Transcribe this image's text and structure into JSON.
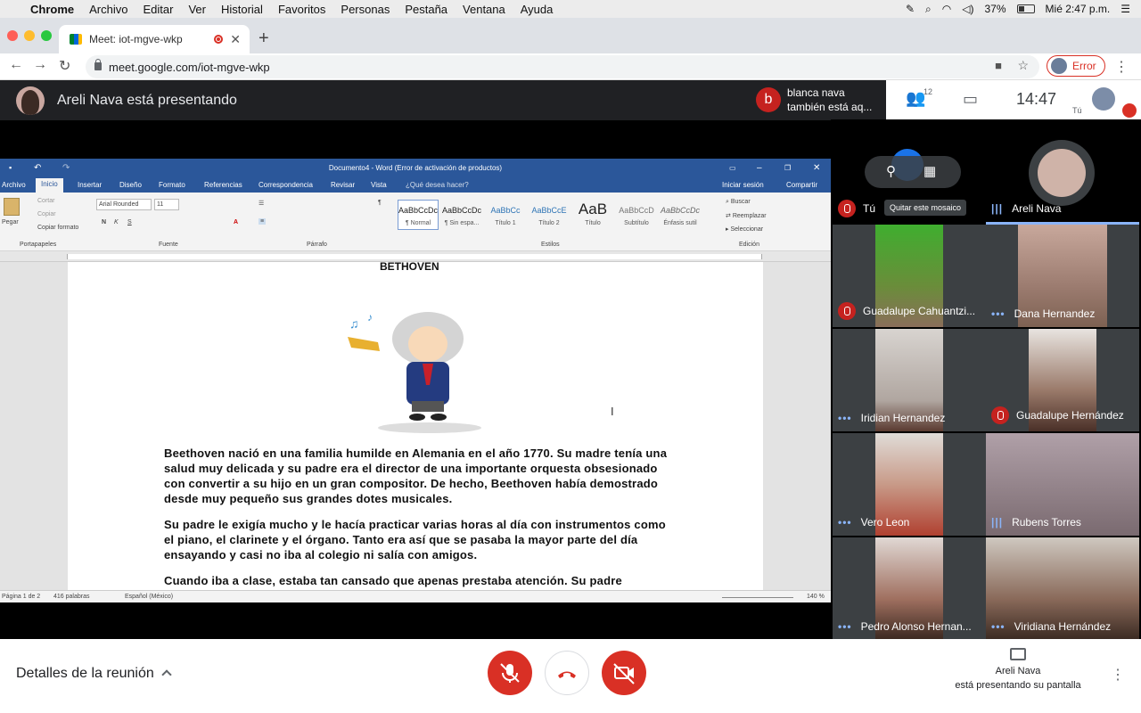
{
  "menubar": {
    "app": "Chrome",
    "items": [
      "Archivo",
      "Editar",
      "Ver",
      "Historial",
      "Favoritos",
      "Personas",
      "Pestaña",
      "Ventana",
      "Ayuda"
    ],
    "battery": "37%",
    "datetime": "Mié 2:47 p.m."
  },
  "browser": {
    "tab_title": "Meet: iot-mgve-wkp",
    "url": "meet.google.com/iot-mgve-wkp",
    "profile_label": "Error"
  },
  "meet": {
    "presenting_banner": "Areli Nava está presentando",
    "toast_initial": "b",
    "toast_line1": "blanca nava",
    "toast_line2": "también está aq...",
    "participants_count": "12",
    "time": "14:47",
    "self_label": "Tú",
    "details_label": "Detalles de la reunión",
    "presenter_name": "Areli Nava",
    "presenter_sub": "está presentando su pantalla",
    "colors": {
      "red": "#d93025",
      "accent": "#8ab4f8",
      "dark": "#202124"
    }
  },
  "word": {
    "title": "Documento4 - Word (Error de activación de productos)",
    "tabs": [
      "Archivo",
      "Inicio",
      "Insertar",
      "Diseño",
      "Formato",
      "Referencias",
      "Correspondencia",
      "Revisar",
      "Vista"
    ],
    "tell_me": "¿Qué desea hacer?",
    "signin": "Iniciar sesión",
    "share": "Compartir",
    "font_name": "Arial Rounded",
    "font_size": "11",
    "clipboard": {
      "paste": "Pegar",
      "cut": "Cortar",
      "copy": "Copiar",
      "format": "Copiar formato"
    },
    "groups": [
      "Portapapeles",
      "Fuente",
      "Párrafo",
      "Estilos",
      "Edición"
    ],
    "styles": [
      {
        "sample": "AaBbCcDc",
        "name": "¶ Normal"
      },
      {
        "sample": "AaBbCcDc",
        "name": "¶ Sin espa..."
      },
      {
        "sample": "AaBbCc",
        "name": "Título 1"
      },
      {
        "sample": "AaBbCcE",
        "name": "Título 2"
      },
      {
        "sample": "AaB",
        "name": "Título"
      },
      {
        "sample": "AaBbCcD",
        "name": "Subtítulo"
      },
      {
        "sample": "AaBbCcDc",
        "name": "Énfasis sutil"
      }
    ],
    "editing": [
      "Buscar",
      "Reemplazar",
      "Seleccionar"
    ],
    "doc_title": "BETHOVEN",
    "paragraphs": [
      "Beethoven nació en una familia humilde en Alemania en el año 1770. Su madre tenía una salud muy delicada y su padre era el director de una importante orquesta obsesionado con convertir a su hijo en un gran compositor. De hecho, Beethoven había demostrado desde muy pequeño sus grandes dotes musicales.",
      "Su padre le exigía mucho y le hacía practicar varias horas al día con instrumentos como el piano, el clarinete y el órgano. Tanto era así que se pasaba la mayor parte del día ensayando y casi no iba al colegio ni salía con amigos.",
      " Cuando iba a clase, estaba tan cansado que apenas prestaba atención. Su padre"
    ],
    "status_page": "Página 1 de 2",
    "status_words": "416 palabras",
    "status_lang": "Español (México)",
    "zoom": "140 %"
  },
  "tiles": [
    {
      "name": "Tú",
      "muted": true,
      "tooltip": "Quitar este mosaico"
    },
    {
      "name": "Areli Nava",
      "muted": false
    },
    {
      "name": "Guadalupe Cahuantzi...",
      "muted": true
    },
    {
      "name": "Dana Hernandez",
      "muted": false
    },
    {
      "name": "Iridian Hernandez",
      "muted": false
    },
    {
      "name": "Guadalupe Hernández",
      "muted": true
    },
    {
      "name": "Vero Leon",
      "muted": false
    },
    {
      "name": "Rubens Torres",
      "muted": false
    },
    {
      "name": "Pedro Alonso Hernan...",
      "muted": false
    },
    {
      "name": "Viridiana Hernández",
      "muted": false
    }
  ]
}
